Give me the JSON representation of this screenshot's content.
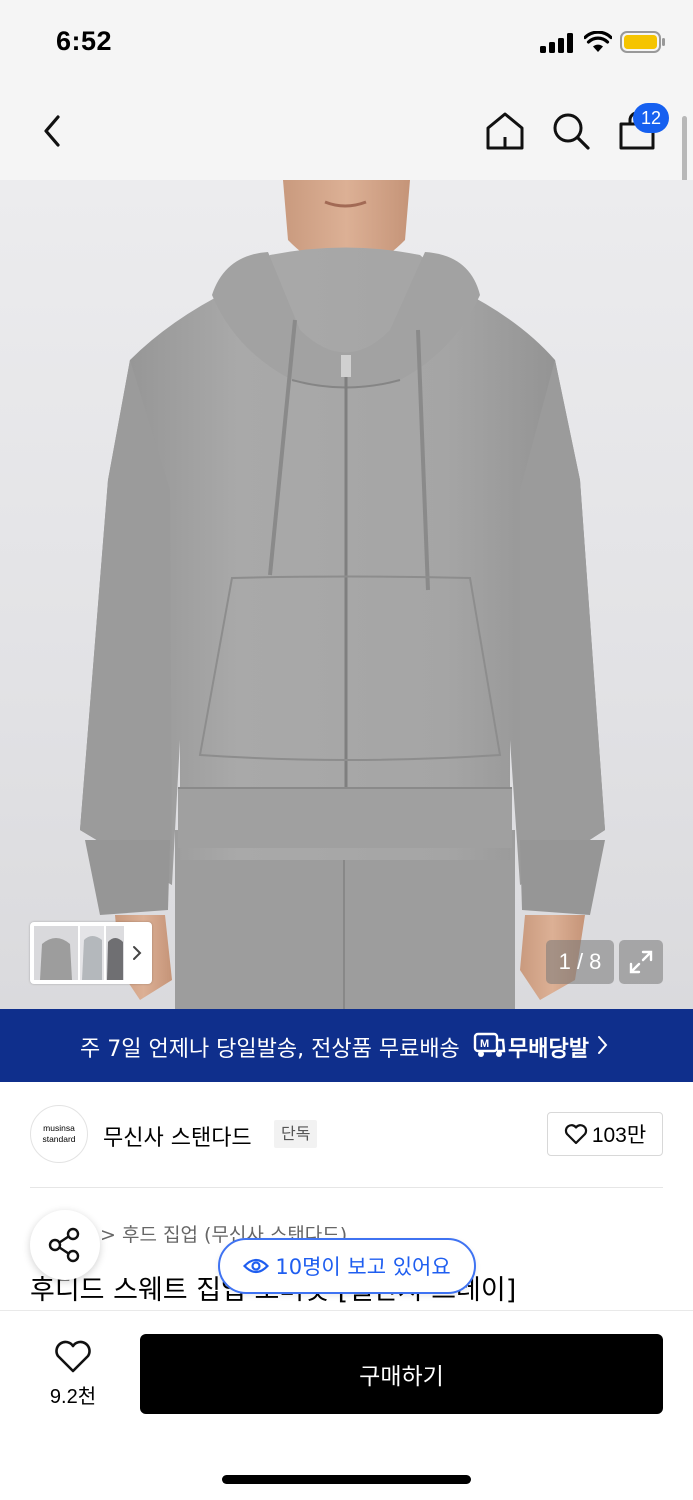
{
  "status_bar": {
    "time": "6:52"
  },
  "nav": {
    "cart_count": "12"
  },
  "gallery": {
    "counter": "1 / 8"
  },
  "banner": {
    "text": "주 7일 언제나 당일발송, 전상품 무료배송",
    "logo_text": "무배당발"
  },
  "brand": {
    "logo_line1": "musinsa",
    "logo_line2": "standard",
    "name": "무신사 스탠다드",
    "tag": "단독",
    "likes": "103만"
  },
  "product": {
    "breadcrumb": "> 후드 집업 (무신사 스탠다드)",
    "title": "후디드 스웨트 집업 오버핏 [멜란지 그레이]",
    "viewing": "10명이 보고 있어요"
  },
  "bottom_bar": {
    "wish_count": "9.2천",
    "buy_label": "구매하기"
  },
  "colors": {
    "accent_blue": "#1660f0",
    "banner_navy": "#0f2f8c",
    "buy_black": "#000000"
  }
}
